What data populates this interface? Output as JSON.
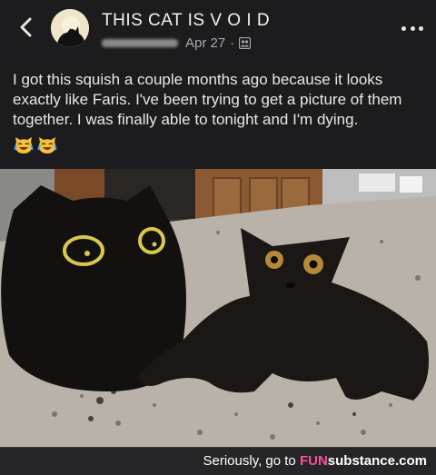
{
  "post": {
    "group_name": "THIS CAT IS V O I D",
    "date": "Apr 27",
    "separator": "·",
    "text": "I got this squish a couple months ago because it looks exactly like Faris. I've been trying to get a picture of them together. I was finally able to tonight and I'm dying.",
    "emojis": [
      "tears-of-joy-cat-emoji",
      "tears-of-joy-cat-emoji"
    ]
  },
  "icons": {
    "back": "chevron-left-icon",
    "audience": "group-members-icon",
    "more": "more-options-icon"
  },
  "footer": {
    "lead": "Seriously, go to ",
    "brand": "FUN",
    "brand_tail": "substance.com"
  },
  "colors": {
    "background": "#1c1c1e",
    "text": "#e8e8e8",
    "meta": "#a9a9ab",
    "footer_bg": "#262629",
    "avatar_bg": "#efe6c9"
  }
}
